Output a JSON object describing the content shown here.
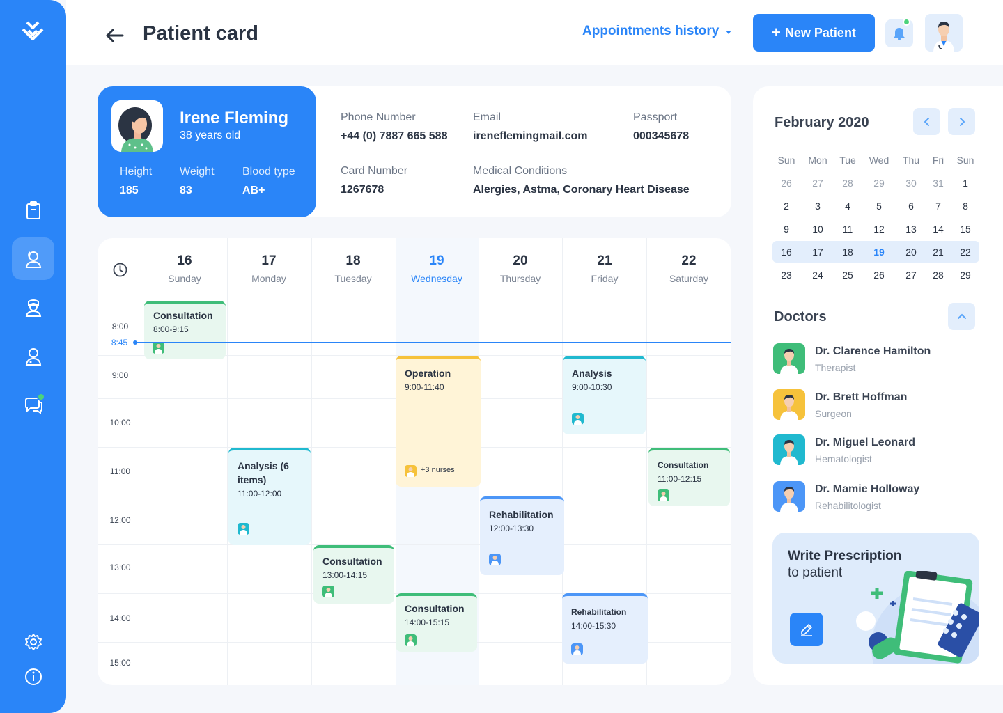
{
  "header": {
    "title": "Patient card",
    "history_label": "Appointments history",
    "new_patient_label": "New Patient"
  },
  "patient": {
    "name": "Irene Fleming",
    "age": "38 years old",
    "stats": [
      {
        "label": "Height",
        "value": "185"
      },
      {
        "label": "Weight",
        "value": "83"
      },
      {
        "label": "Blood type",
        "value": "AB+"
      }
    ],
    "fields": {
      "phone_label": "Phone Number",
      "phone": "+44 (0) 7887 665 588",
      "email_label": "Email",
      "email": "ireneflemingmail.com",
      "passport_label": "Passport",
      "passport": "000345678",
      "card_label": "Card Number",
      "card": "1267678",
      "conditions_label": "Medical Conditions",
      "conditions": "Alergies, Astma, Coronary Heart Disease"
    }
  },
  "schedule": {
    "days": [
      {
        "num": "16",
        "name": "Sunday"
      },
      {
        "num": "17",
        "name": "Monday"
      },
      {
        "num": "18",
        "name": "Tuesday"
      },
      {
        "num": "19",
        "name": "Wednesday"
      },
      {
        "num": "20",
        "name": "Thursday"
      },
      {
        "num": "21",
        "name": "Friday"
      },
      {
        "num": "22",
        "name": "Saturday"
      }
    ],
    "times": [
      "8:00",
      "9:00",
      "10:00",
      "11:00",
      "12:00",
      "13:00",
      "14:00",
      "15:00"
    ],
    "now": "8:45",
    "events": [
      {
        "title": "Consultation",
        "time": "8:00-9:15"
      },
      {
        "title": "Analysis (6 items)",
        "time": "11:00-12:00"
      },
      {
        "title": "Consultation",
        "time": "13:00-14:15"
      },
      {
        "title": "Operation",
        "time": "9:00-11:40",
        "extra": "+3 nurses"
      },
      {
        "title": "Consultation",
        "time": "14:00-15:15"
      },
      {
        "title": "Rehabilitation",
        "time": "12:00-13:30"
      },
      {
        "title": "Analysis",
        "time": "9:00-10:30"
      },
      {
        "title": "Rehabilitation",
        "time": "14:00-15:30"
      },
      {
        "title": "Consultation",
        "time": "11:00-12:15"
      }
    ]
  },
  "calendar": {
    "title": "February 2020",
    "dow": [
      "Sun",
      "Mon",
      "Tue",
      "Wed",
      "Thu",
      "Fri",
      "Sun"
    ],
    "weeks": [
      [
        "26",
        "27",
        "28",
        "29",
        "30",
        "31",
        "1"
      ],
      [
        "2",
        "3",
        "4",
        "5",
        "6",
        "7",
        "8"
      ],
      [
        "9",
        "10",
        "11",
        "12",
        "13",
        "14",
        "15"
      ],
      [
        "16",
        "17",
        "18",
        "19",
        "20",
        "21",
        "22"
      ],
      [
        "23",
        "24",
        "25",
        "26",
        "27",
        "28",
        "29"
      ]
    ],
    "today": "19"
  },
  "doctors": {
    "title": "Doctors",
    "items": [
      {
        "name": "Dr. Clarence Hamilton",
        "spec": "Therapist",
        "color": "#3fbd79"
      },
      {
        "name": "Dr. Brett Hoffman",
        "spec": "Surgeon",
        "color": "#f6c23b"
      },
      {
        "name": "Dr. Miguel Leonard",
        "spec": "Hematologist",
        "color": "#20b9cf"
      },
      {
        "name": "Dr. Mamie Holloway",
        "spec": "Rehabilitologist",
        "color": "#4c96f7"
      }
    ]
  },
  "prescription": {
    "line1": "Write Prescription",
    "line2": "to patient"
  },
  "colors": {
    "accent": "#2a85f8",
    "green": "#3fbd79",
    "cyan": "#20b9cf",
    "yellow": "#f6c23b",
    "blue": "#4c96f7"
  }
}
